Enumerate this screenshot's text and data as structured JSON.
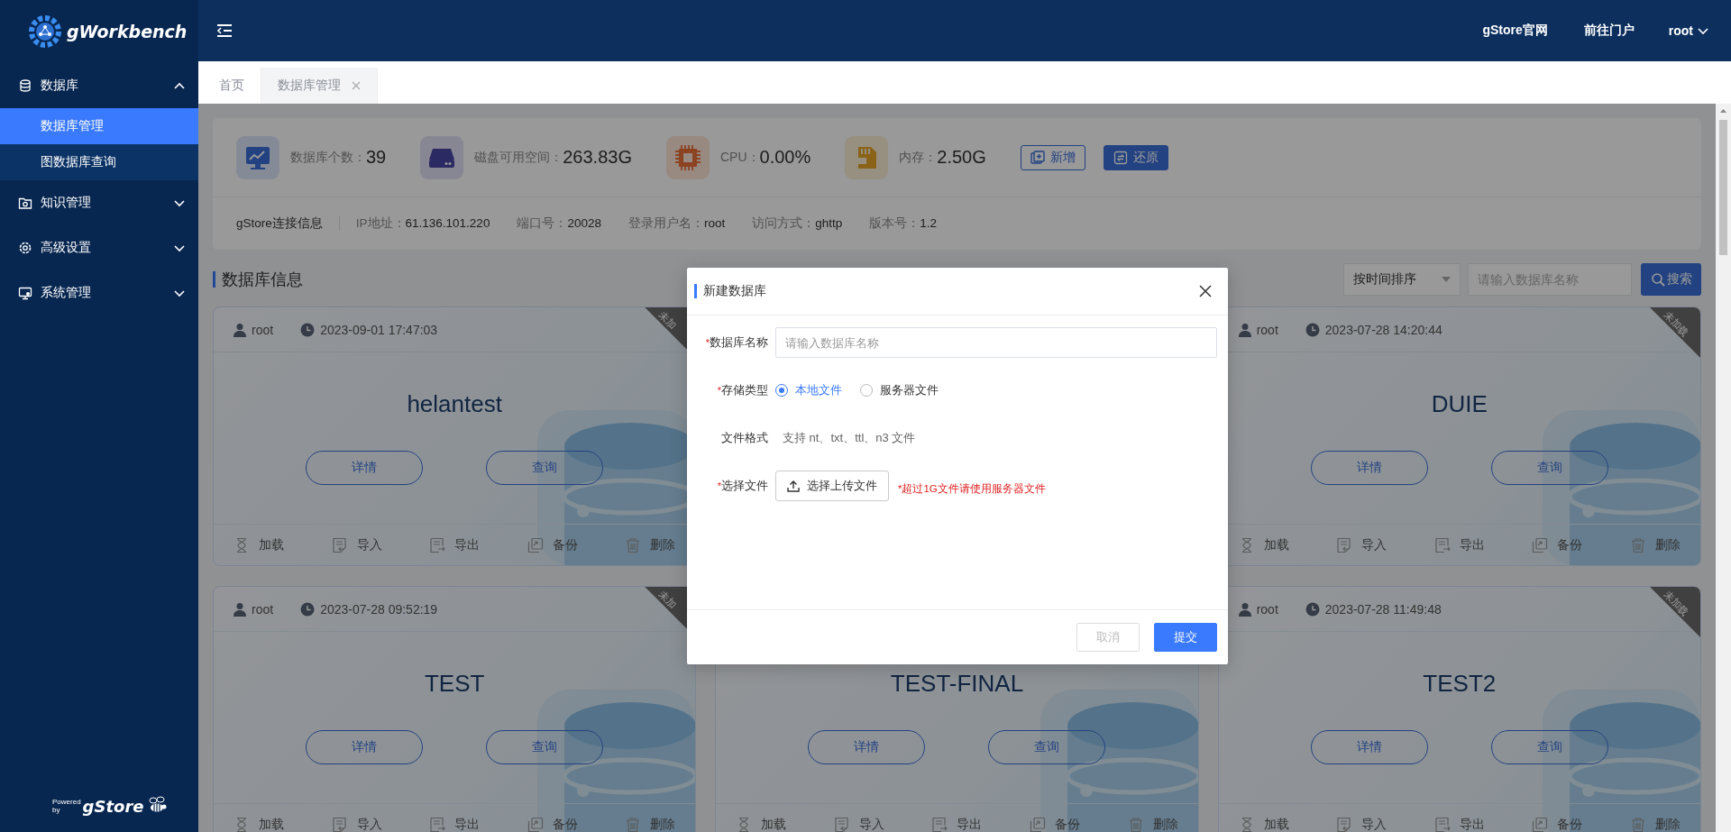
{
  "sidebar": {
    "title": "gWorkbench",
    "menu": [
      {
        "label": "数据库",
        "expanded": true,
        "children": [
          {
            "label": "数据库管理",
            "selected": true
          },
          {
            "label": "图数据库查询",
            "selected": false
          }
        ]
      },
      {
        "label": "知识管理",
        "expanded": false
      },
      {
        "label": "高级设置",
        "expanded": false
      },
      {
        "label": "系统管理",
        "expanded": false
      }
    ],
    "powered_by": {
      "line_1": "Powered",
      "line_2": "by",
      "brand": "gStore"
    }
  },
  "header": {
    "links": [
      "gStore官网",
      "前往门户"
    ],
    "user": "root"
  },
  "tabs": [
    {
      "label": "首页",
      "selected": false,
      "closable": false
    },
    {
      "label": "数据库管理",
      "selected": true,
      "closable": true
    }
  ],
  "stats": {
    "items": [
      {
        "label": "数据库个数：",
        "value": "39"
      },
      {
        "label": "磁盘可用空间：",
        "value": "263.83G"
      },
      {
        "label": "CPU：",
        "value": "0.00%"
      },
      {
        "label": "内存：",
        "value": "2.50G"
      }
    ],
    "buttons": [
      {
        "label": "新增",
        "kind": "outline"
      },
      {
        "label": "还原",
        "kind": "primary"
      }
    ]
  },
  "connection": {
    "title": "gStore连接信息",
    "items": [
      {
        "label": "IP地址：",
        "value": "61.136.101.220"
      },
      {
        "label": "端口号：",
        "value": "20028"
      },
      {
        "label": "登录用户名：",
        "value": "root"
      },
      {
        "label": "访问方式：",
        "value": "ghttp"
      },
      {
        "label": "版本号：",
        "value": "1.2"
      }
    ]
  },
  "section": {
    "title": "数据库信息",
    "sort": "按时间排序",
    "search_placeholder": "请输入数据库名称",
    "search_button": "搜索"
  },
  "cards": [
    {
      "kind": "database",
      "user": "root",
      "time": "2023-09-01 17:47:03",
      "badge": "未加",
      "name": "helantest",
      "buttons": [
        "详情",
        "查询"
      ],
      "actions": [
        "加载",
        "导入",
        "导出",
        "备份",
        "删除"
      ]
    },
    {
      "kind": "covered"
    },
    {
      "kind": "database",
      "user": "root",
      "time": "2023-07-28 14:20:44",
      "badge": "未加载",
      "name": "DUIE",
      "buttons": [
        "详情",
        "查询"
      ],
      "actions": [
        "加载",
        "导入",
        "导出",
        "备份",
        "删除"
      ]
    },
    {
      "kind": "database",
      "user": "root",
      "time": "2023-07-28 09:52:19",
      "badge": "未加",
      "name": "TEST",
      "buttons": [
        "详情",
        "查询"
      ],
      "actions": [
        "加载",
        "导入",
        "导出",
        "备份",
        "删除"
      ]
    },
    {
      "kind": "database",
      "name": "TEST-FINAL",
      "buttons": [
        "详情",
        "查询"
      ],
      "actions": [
        "加载",
        "导入",
        "导出",
        "备份",
        "删除"
      ]
    },
    {
      "kind": "database",
      "user": "root",
      "time": "2023-07-28 11:49:48",
      "badge": "未加载",
      "name": "TEST2",
      "buttons": [
        "详情",
        "查询"
      ],
      "actions": [
        "加载",
        "导入",
        "导出",
        "备份",
        "删除"
      ]
    }
  ],
  "modal": {
    "title": "新建数据库",
    "fields": [
      {
        "kind": "input",
        "mark": "*",
        "label": "数据库名称",
        "placeholder": "请输入数据库名称"
      },
      {
        "kind": "radio",
        "mark": "*",
        "label": "存储类型",
        "options": [
          {
            "label": "本地文件",
            "selected": true
          },
          {
            "label": "服务器文件",
            "selected": false
          }
        ]
      },
      {
        "kind": "text",
        "label": "文件格式",
        "value": "支持 nt、txt、ttl、n3 文件"
      },
      {
        "kind": "upload",
        "mark": "*",
        "label": "选择文件",
        "button": "选择上传文件",
        "hint": "*超过1G文件请使用服务器文件"
      }
    ],
    "buttons": [
      {
        "label": "取消",
        "kind": "default",
        "disabled": true
      },
      {
        "label": "提交",
        "kind": "primary",
        "disabled": false
      }
    ]
  }
}
